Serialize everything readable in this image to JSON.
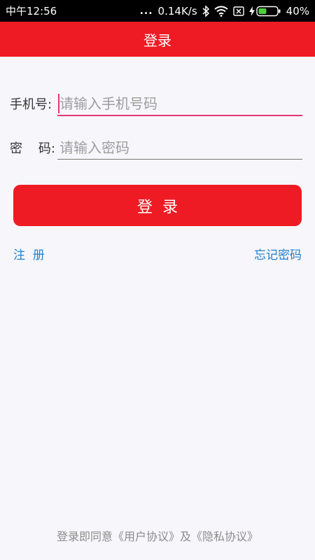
{
  "status_bar": {
    "time": "中午12:56",
    "dots": "...",
    "network_speed": "0.14K/s",
    "battery_percent": "40%",
    "icons": [
      "bluetooth-icon",
      "wifi-icon",
      "sim-x-icon",
      "charging-icon",
      "battery-icon"
    ]
  },
  "header": {
    "title": "登录"
  },
  "form": {
    "phone_label": "手机号:",
    "phone_placeholder": "请输入手机号码",
    "password_label": "密    码:",
    "password_placeholder": "请输入密码"
  },
  "login_button": "登  录",
  "links": {
    "register": "注  册",
    "forgot": "忘记密码"
  },
  "footer": "登录即同意《用户协议》及《隐私协议》",
  "colors": {
    "primary": "#ef1b24",
    "link": "#1e7fcf",
    "focus_underline": "#e6347a",
    "background": "#f7f6fa"
  }
}
